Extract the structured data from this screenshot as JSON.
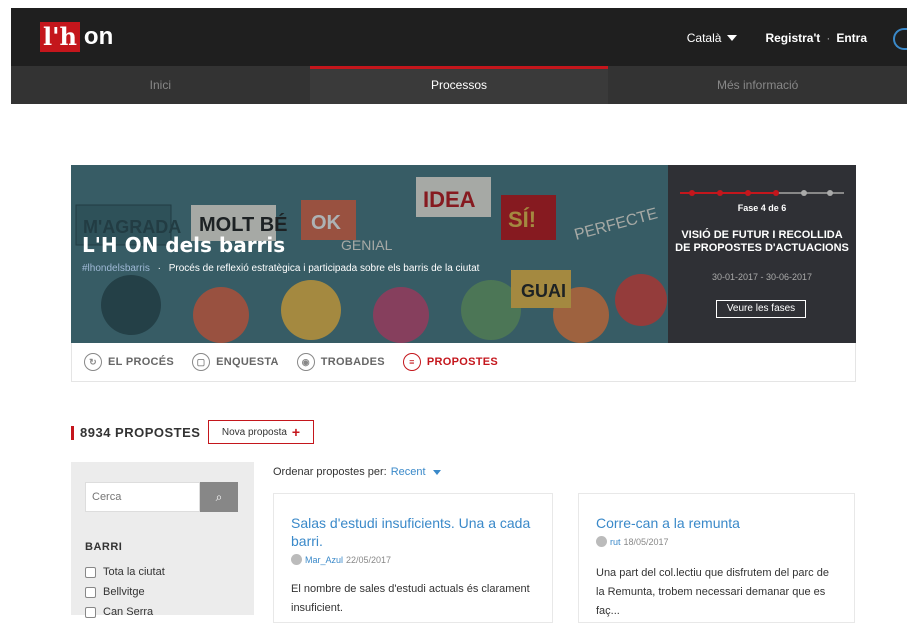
{
  "header": {
    "logo_mark": "l'h",
    "logo_text": "on",
    "language": "Català",
    "register": "Registra't",
    "separator": "·",
    "login": "Entra"
  },
  "nav": {
    "items": [
      {
        "label": "Inici"
      },
      {
        "label": "Processos"
      },
      {
        "label": "Més informació"
      }
    ],
    "active": "Processos"
  },
  "hero": {
    "title": "L'H ON dels barris",
    "hashtag": "#lhondelsbarris",
    "dot": "·",
    "subtitle": "Procés de reflexió estratègica i participada sobre els barris de la ciutat",
    "sign_words": [
      "MOLT BÉ",
      "OK",
      "IDEA",
      "SÍ!",
      "GENIAL",
      "PERFECTE",
      "GUAI",
      "M'AGRADA"
    ],
    "phase": {
      "label": "Fase 4 de 6",
      "current": 4,
      "total": 6,
      "name": "VISIÓ DE FUTUR I RECOLLIDA DE PROPOSTES D'ACTUACIONS",
      "dates": "30-01-2017 - 30-06-2017",
      "button": "Veure les fases"
    }
  },
  "tabs": [
    {
      "label": "EL PROCÉS",
      "icon": "process-icon"
    },
    {
      "label": "ENQUESTA",
      "icon": "survey-icon"
    },
    {
      "label": "TROBADES",
      "icon": "location-icon"
    },
    {
      "label": "PROPOSTES",
      "icon": "proposals-icon"
    }
  ],
  "active_tab": "PROPOSTES",
  "proposals": {
    "count_label": "8934 PROPOSTES",
    "new_button": "Nova proposta",
    "order_label": "Ordenar propostes per:",
    "order_value": "Recent"
  },
  "sidebar": {
    "search_placeholder": "Cerca",
    "filter_title": "BARRI",
    "options": [
      "Tota la ciutat",
      "Bellvitge",
      "Can Serra"
    ]
  },
  "cards": [
    {
      "title": "Salas d'estudi insuficients. Una a cada barri.",
      "author": "Mar_Azul",
      "date": "22/05/2017",
      "body": "El nombre de sales d'estudi actuals és clarament insuficient."
    },
    {
      "title": "Corre-can a la remunta",
      "author": "rut",
      "date": "18/05/2017",
      "body": "Una part del col.lectiu que disfrutem del parc de la Remunta, trobem necessari demanar que es faç..."
    }
  ],
  "colors": {
    "brand_red": "#c4161c",
    "link_blue": "#3a89c9",
    "topbar": "#1f1f1f",
    "nav": "#333333"
  }
}
